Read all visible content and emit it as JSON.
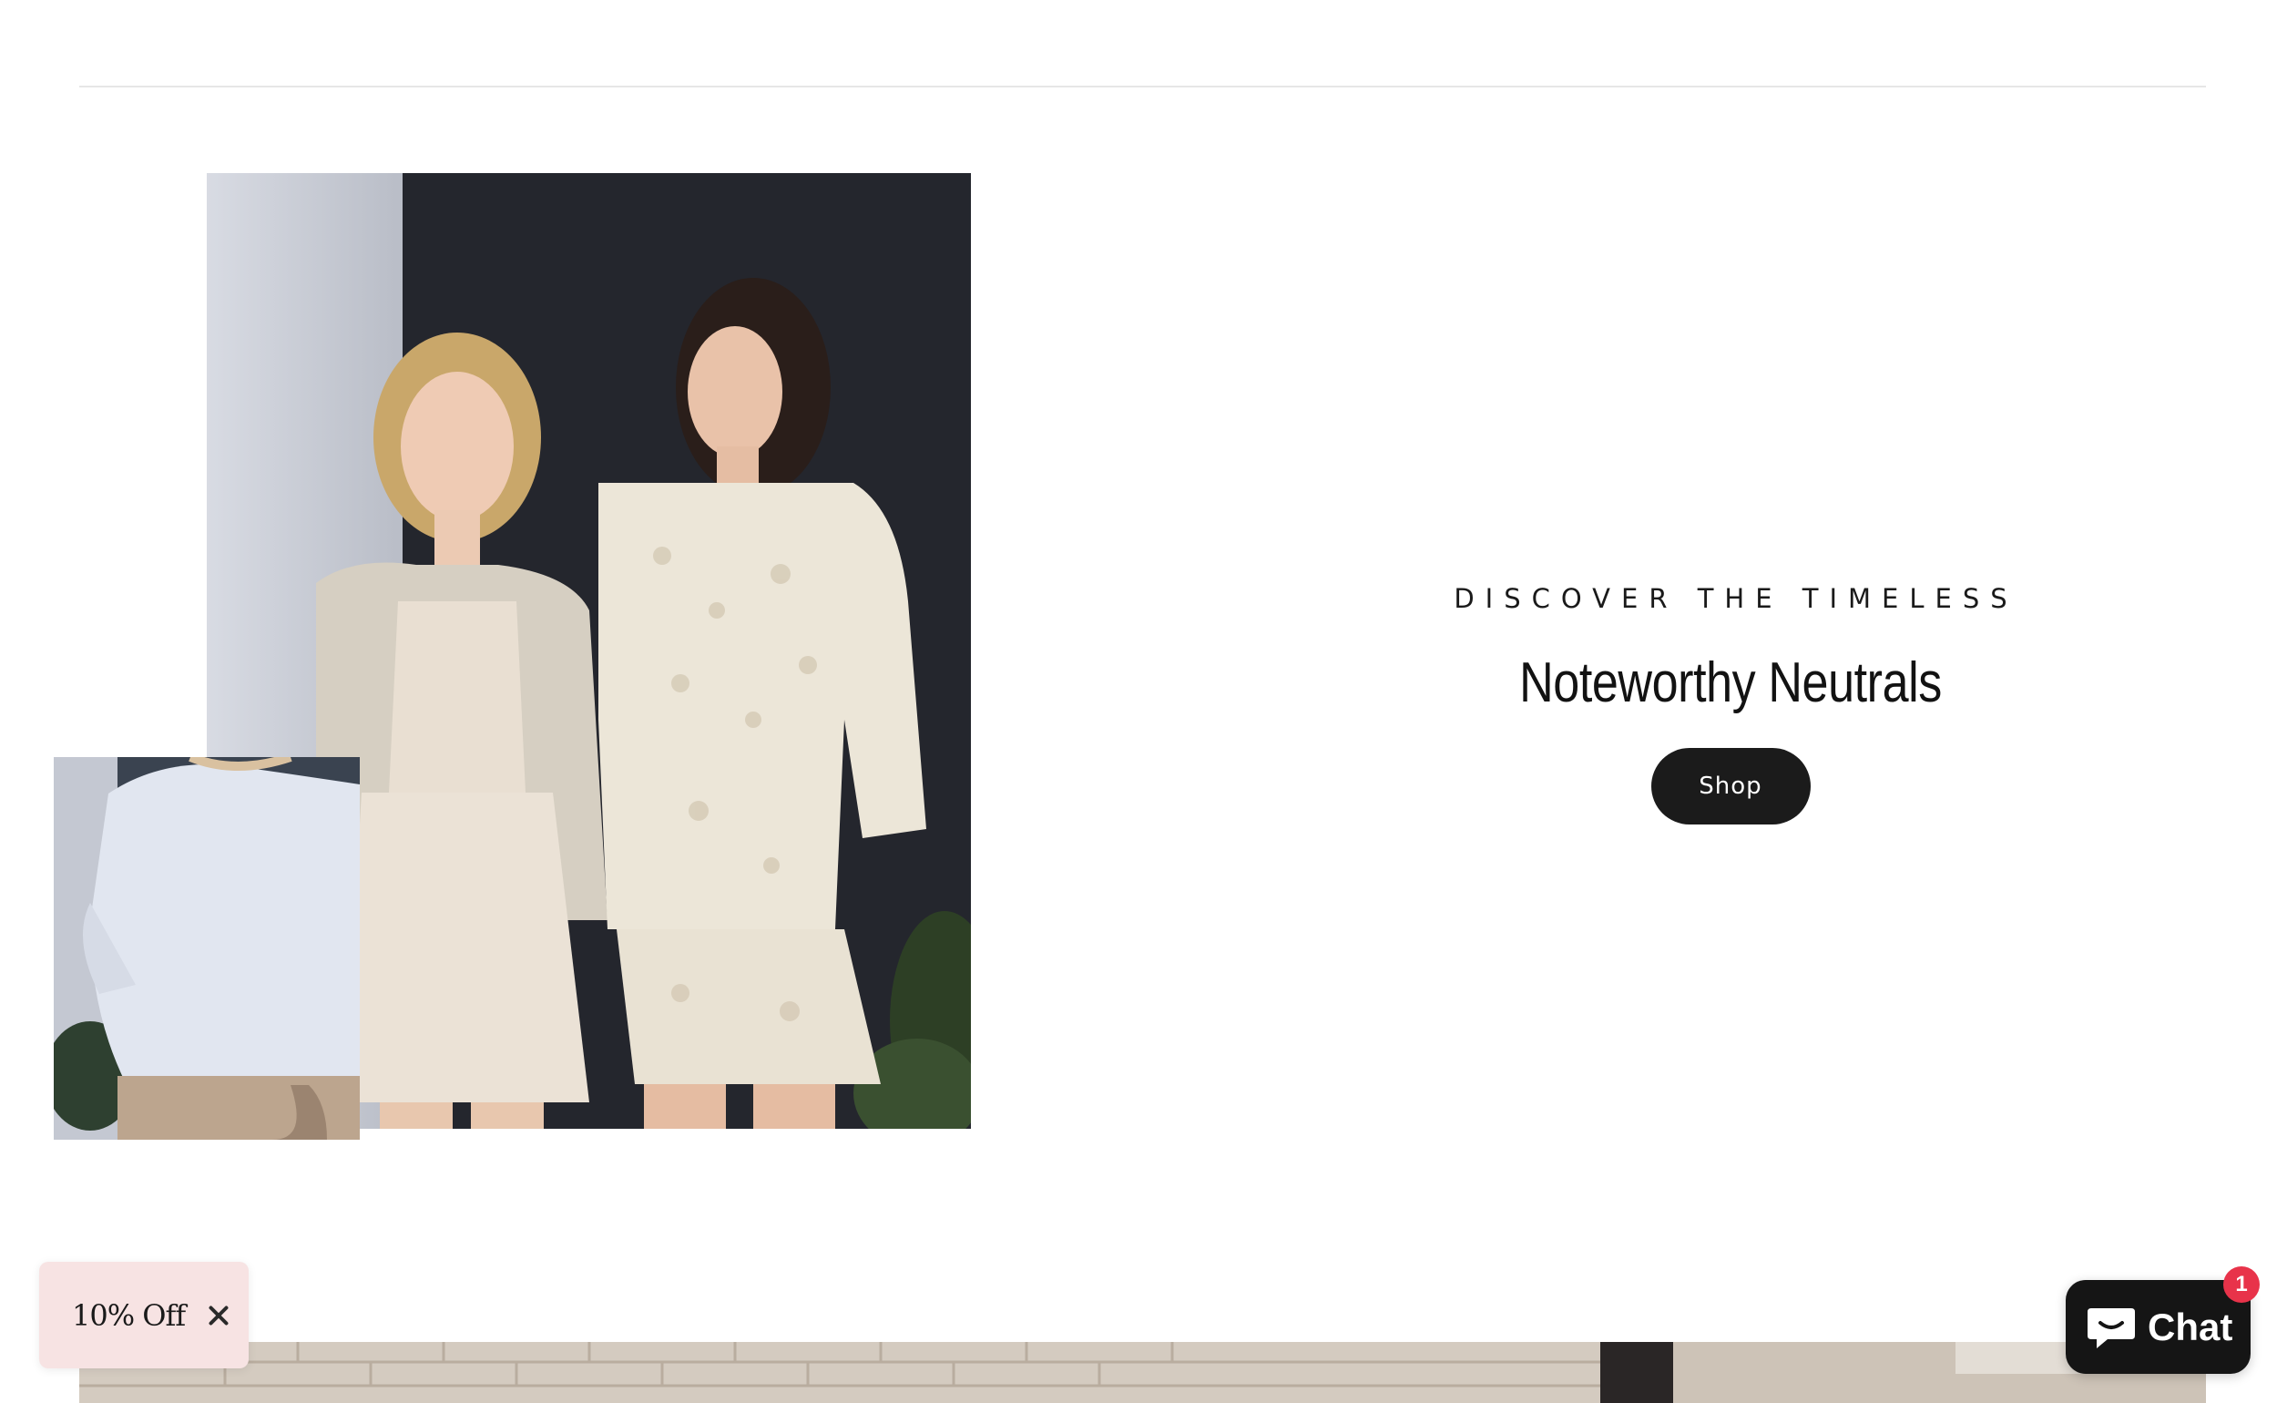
{
  "hero": {
    "eyebrow": "DISCOVER THE TIMELESS",
    "heading": "Noteworthy Neutrals",
    "cta_label": "Shop"
  },
  "images": {
    "main": "two-models-neutral-outfits-photo",
    "inset": "white-blouse-closeup-photo",
    "banner": "brick-wall-banner-photo"
  },
  "discount": {
    "label": "10% Off"
  },
  "chat": {
    "label": "Chat",
    "badge_count": "1"
  },
  "colors": {
    "button_bg": "#1b1b1b",
    "discount_bg": "#f7e3e3",
    "badge": "#e8334a"
  }
}
